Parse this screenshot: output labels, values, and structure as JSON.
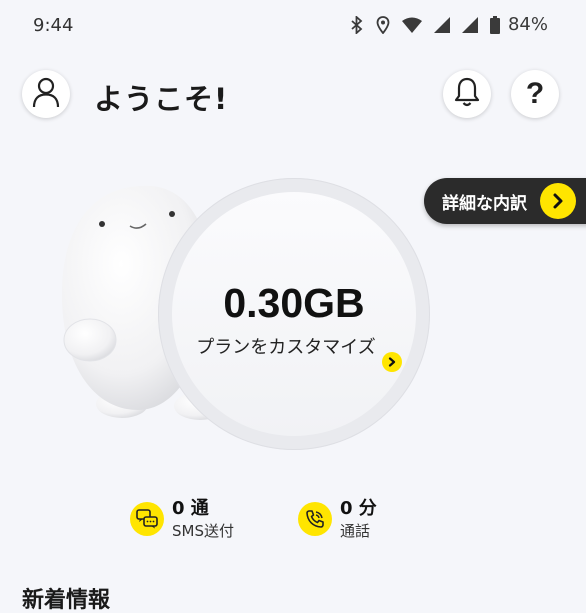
{
  "status_bar": {
    "time": "9:44",
    "battery": "84%",
    "icons": [
      "bluetooth-icon",
      "location-icon",
      "wifi-icon",
      "signal-icon",
      "signal-icon",
      "battery-icon"
    ]
  },
  "header": {
    "welcome": "ようこそ!",
    "help_glyph": "?"
  },
  "detail_button": {
    "label": "詳細な内訳"
  },
  "data_usage": {
    "amount": "0.30GB",
    "plan_link": "プランをカスタマイズ"
  },
  "stats": {
    "sms": {
      "value": "0 通",
      "label": "SMS送付"
    },
    "call": {
      "value": "0 分",
      "label": "通話"
    }
  },
  "news": {
    "heading": "新着情報"
  },
  "colors": {
    "accent": "#ffe500",
    "pill_dark": "#2b2b2b",
    "background": "#f5f6fa"
  }
}
